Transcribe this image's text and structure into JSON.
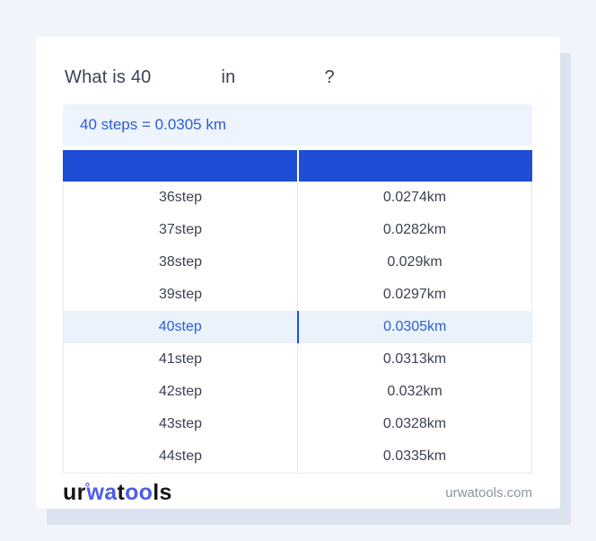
{
  "colors": {
    "page_bg": "#f1f4fa",
    "card_bg": "#ffffff",
    "card_shadow": "#dce2f0",
    "title_text": "#3b4256",
    "result_bg": "#eef4fd",
    "result_text": "#2c5cd6",
    "header_bg": "#1e4ed6",
    "row_text": "#3b4351",
    "row_divider": "#e6e8ec",
    "table_border": "#e8eaee",
    "highlight_bg": "#eaf2fc",
    "highlight_text": "#2d5fd0",
    "highlight_divider": "#1d4fd8",
    "logo_dark": "#16161a",
    "logo_blue": "#4f5be7",
    "site_text": "#8d93a3"
  },
  "title": {
    "part1": "What is 40",
    "part2": "in",
    "part3": "?"
  },
  "result": {
    "text": "40 steps = 0.0305 km"
  },
  "table": {
    "header": {
      "col1": "",
      "col2": ""
    },
    "rows": [
      {
        "steps": "36step",
        "km": "0.0274km",
        "highlighted": false
      },
      {
        "steps": "37step",
        "km": "0.0282km",
        "highlighted": false
      },
      {
        "steps": "38step",
        "km": "0.029km",
        "highlighted": false
      },
      {
        "steps": "39step",
        "km": "0.0297km",
        "highlighted": false
      },
      {
        "steps": "40step",
        "km": "0.0305km",
        "highlighted": true
      },
      {
        "steps": "41step",
        "km": "0.0313km",
        "highlighted": false
      },
      {
        "steps": "42step",
        "km": "0.032km",
        "highlighted": false
      },
      {
        "steps": "43step",
        "km": "0.0328km",
        "highlighted": false
      },
      {
        "steps": "44step",
        "km": "0.0335km",
        "highlighted": false
      }
    ]
  },
  "footer": {
    "logo": {
      "part1": "ur",
      "mark": "°",
      "part2": "wa",
      "part3": "t",
      "part4": "oo",
      "part5": "ls"
    },
    "site": "urwatools.com"
  }
}
